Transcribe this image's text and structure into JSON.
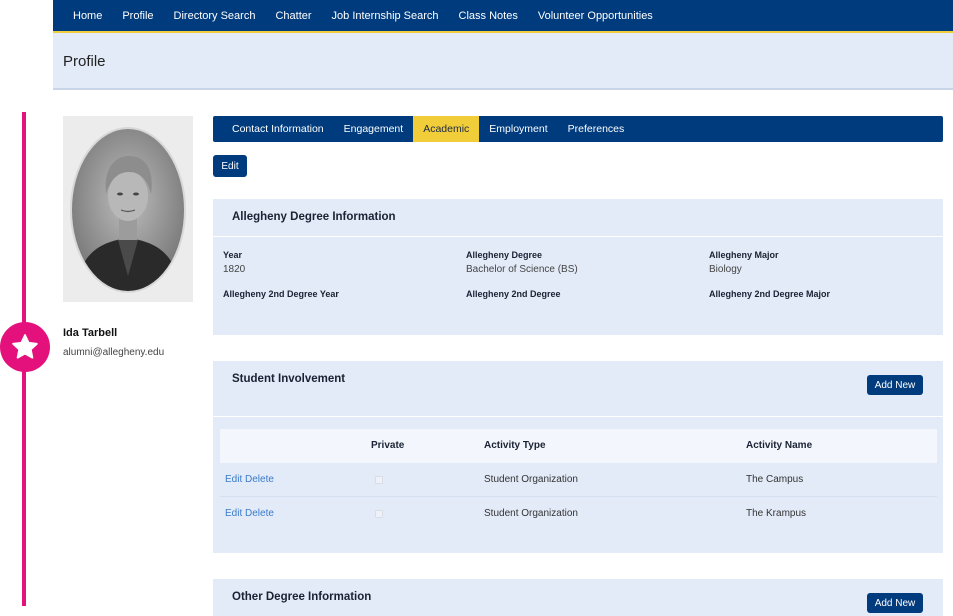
{
  "nav": [
    "Home",
    "Profile",
    "Directory Search",
    "Chatter",
    "Job Internship Search",
    "Class Notes",
    "Volunteer Opportunities"
  ],
  "page": {
    "title": "Profile"
  },
  "profile": {
    "name": "Ida Tarbell",
    "email": "alumni@allegheny.edu"
  },
  "tabs": [
    {
      "label": "Contact Information",
      "active": false
    },
    {
      "label": "Engagement",
      "active": false
    },
    {
      "label": "Academic",
      "active": true
    },
    {
      "label": "Employment",
      "active": false
    },
    {
      "label": "Preferences",
      "active": false
    }
  ],
  "edit_label": "Edit",
  "degree": {
    "title": "Allegheny Degree Information",
    "fields": {
      "year_label": "Year",
      "year_value": "1820",
      "degree_label": "Allegheny Degree",
      "degree_value": "Bachelor of Science (BS)",
      "major_label": "Allegheny Major",
      "major_value": "Biology",
      "year2_label": "Allegheny 2nd Degree Year",
      "degree2_label": "Allegheny 2nd Degree",
      "major2_label": "Allegheny 2nd Degree Major"
    }
  },
  "involvement": {
    "title": "Student Involvement",
    "add_label": "Add New",
    "columns": [
      "Private",
      "Activity Type",
      "Activity Name"
    ],
    "rows": [
      {
        "edit": "Edit",
        "delete": "Delete",
        "private": false,
        "type": "Student Organization",
        "name": "The Campus"
      },
      {
        "edit": "Edit",
        "delete": "Delete",
        "private": false,
        "type": "Student Organization",
        "name": "The Krampus"
      }
    ]
  },
  "other": {
    "title": "Other Degree Information",
    "add_label": "Add New"
  },
  "colors": {
    "navy": "#003b7e",
    "gold": "#f2cd3a",
    "panel": "#e3ebf8",
    "accent": "#e4107c",
    "link": "#3a7bc8"
  }
}
